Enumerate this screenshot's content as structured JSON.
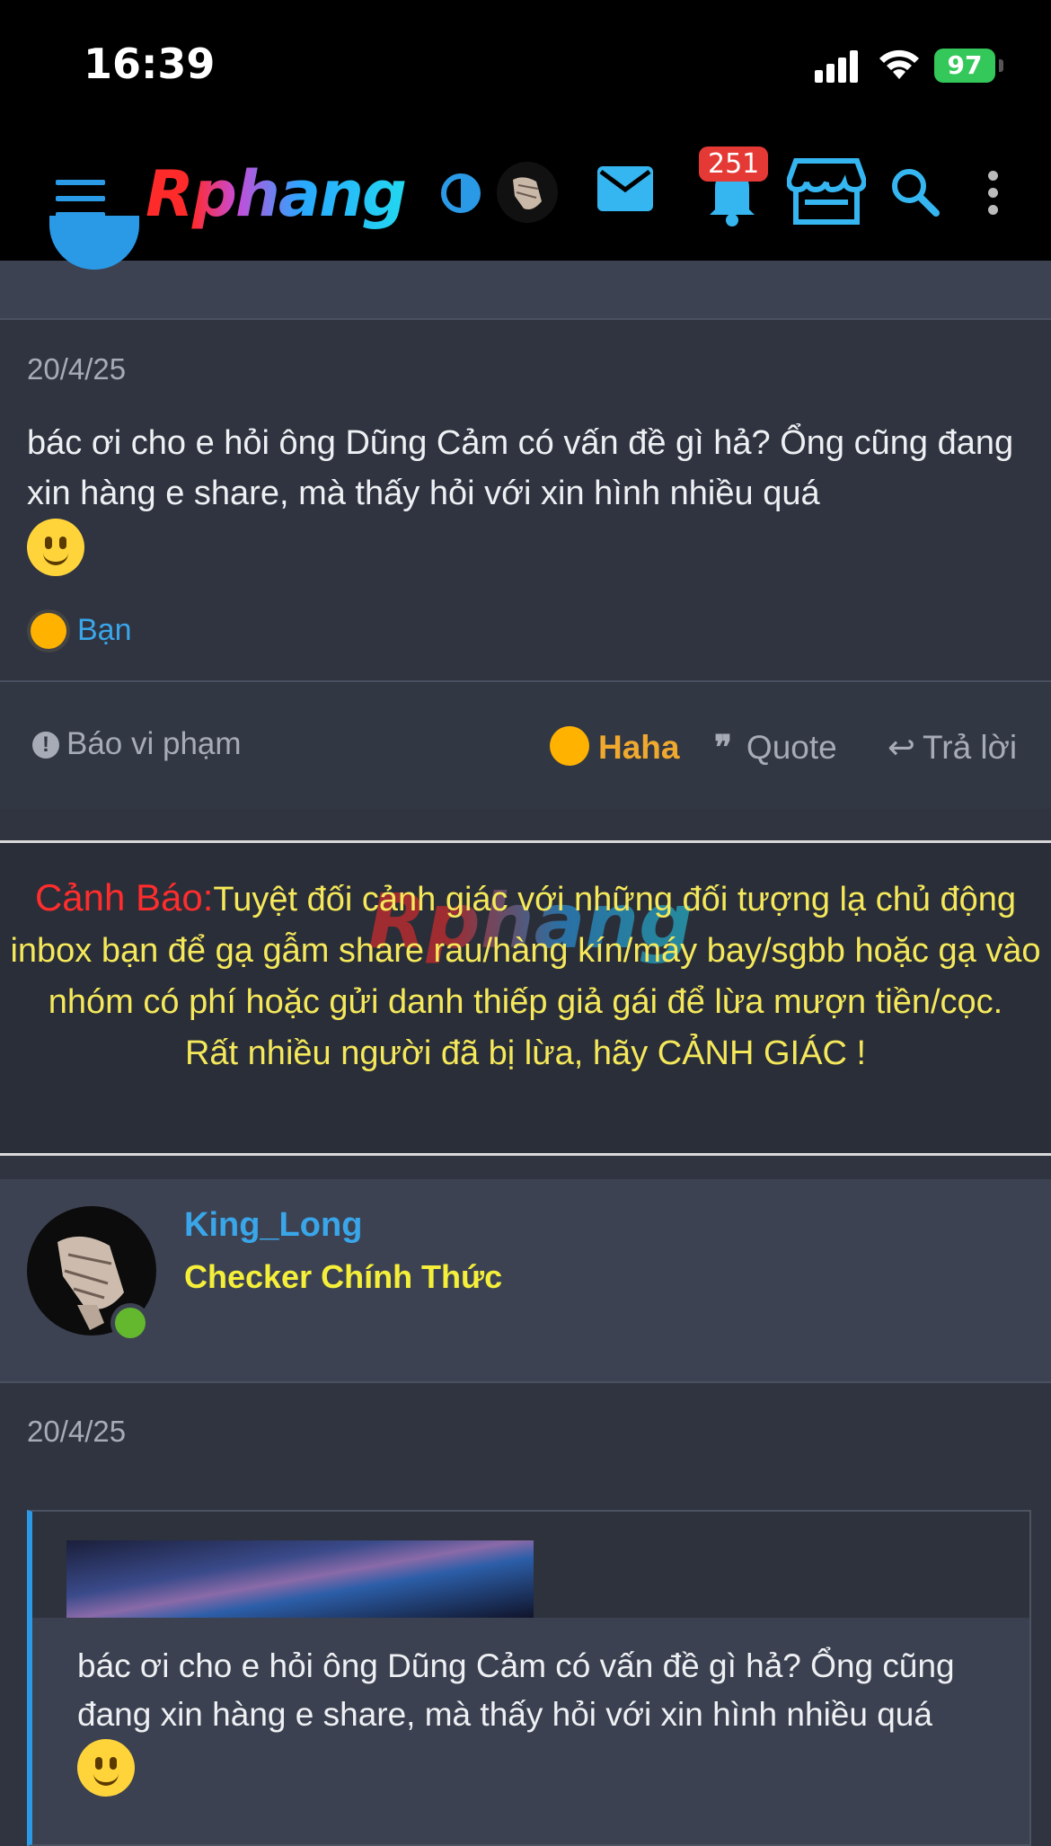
{
  "status_bar": {
    "time": "16:39",
    "battery": "97"
  },
  "navbar": {
    "logo": "Rphang",
    "notification_count": "251",
    "icons": [
      "menu-icon",
      "theme-toggle-icon",
      "avatar",
      "mail-icon",
      "bell-icon",
      "store-icon",
      "search-icon",
      "more-icon"
    ]
  },
  "post1": {
    "date": "20/4/25",
    "text": "bác ơi cho e hỏi ông Dũng Cảm có vấn đề gì hả? Ổng cũng đang xin hàng e share, mà thấy hỏi với xin hình nhiều quá",
    "reaction_user": "Bạn",
    "actions": {
      "report": "Báo vi phạm",
      "haha": "Haha",
      "quote": "Quote",
      "reply": "Trả lời"
    }
  },
  "warning": {
    "title": "Cảnh Báo:",
    "body": "Tuyệt đối cảnh giác với những đối tượng lạ chủ động inbox bạn để gạ gẫm share rau/hàng kín/máy bay/sgbb hoặc gạ vào nhóm có phí hoặc gửi danh thiếp giả gái để lừa mượn tiền/cọc.",
    "footer": "Rất nhiều người đã bị lừa, hãy CẢNH GIÁC !",
    "watermark": "Rphang"
  },
  "post2": {
    "username": "King_Long",
    "user_title": "Checker Chính Thức",
    "date": "20/4/25",
    "quote_text": "bác ơi cho e hỏi ông Dũng Cảm có vấn đề gì hả? Ổng cũng đang xin hàng e share, mà thấy hỏi với xin hình nhiều quá"
  },
  "colors": {
    "accent": "#2b9ae6",
    "warning_title": "#ff2d2d",
    "warning_text": "#f5e85a",
    "user_title": "#f5ef3a",
    "haha": "#f0a92f",
    "badge": "#e53935"
  }
}
